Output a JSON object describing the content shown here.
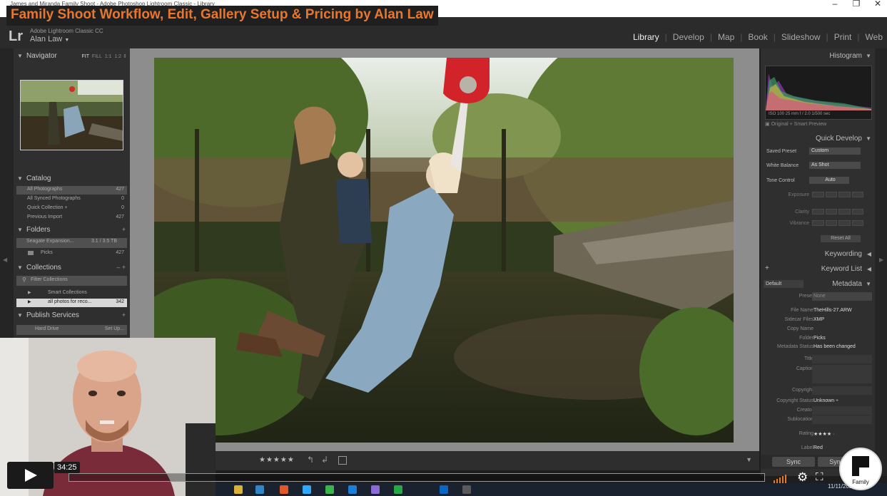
{
  "window": {
    "title": "James and Miranda Family Shoot - Adobe Photoshop Lightroom Classic - Library",
    "minimize": "–",
    "maximize": "❐",
    "close": "✕"
  },
  "video": {
    "title": "Family Shoot Workflow, Edit, Gallery Setup & Pricing by Alan Law",
    "time": "34:25",
    "brand_label": "Family"
  },
  "app": {
    "logo": "Lr",
    "product": "Adobe Lightroom Classic CC",
    "user": "Alan Law",
    "user_caret": "▼"
  },
  "modules": [
    "Library",
    "Develop",
    "Map",
    "Book",
    "Slideshow",
    "Print",
    "Web"
  ],
  "active_module": "Library",
  "left_panel": {
    "navigator": {
      "title": "Navigator",
      "zoom": [
        "FIT",
        "FILL",
        "1:1",
        "1:2"
      ]
    },
    "catalog": {
      "title": "Catalog",
      "items": [
        {
          "name": "All Photographs",
          "count": "427"
        },
        {
          "name": "All Synced Photographs",
          "count": "0"
        },
        {
          "name": "Quick Collection +",
          "count": "0"
        },
        {
          "name": "Previous Import",
          "count": "427"
        }
      ]
    },
    "folders": {
      "title": "Folders",
      "plus": "+",
      "volume": "Seagate Expansion...",
      "volume_info": "3.1 / 3.5 TB",
      "items": [
        {
          "name": "Picks",
          "count": "427"
        }
      ]
    },
    "collections": {
      "title": "Collections",
      "controls": "–  +",
      "filter": "Filter Collections",
      "items": [
        {
          "name": "Smart Collections",
          "count": ""
        },
        {
          "name": "all photos for reco...",
          "count": "342"
        }
      ]
    },
    "publish": {
      "title": "Publish Services",
      "plus": "+",
      "items": [
        {
          "name": "Hard Drive",
          "action": "Set Up..."
        }
      ]
    }
  },
  "toolbar": {
    "stars": "★★★★★"
  },
  "right_panel": {
    "histogram": {
      "title": "Histogram",
      "info": "ISO 100        25 mm        f / 2.0        1/500 sec",
      "preview": "Original + Smart Preview"
    },
    "quick_develop": {
      "title": "Quick Develop",
      "saved_preset": {
        "label": "Saved Preset",
        "value": "Custom"
      },
      "white_balance": {
        "label": "White Balance",
        "value": "As Shot"
      },
      "tone_control": {
        "label": "Tone Control",
        "value": "Auto"
      },
      "sliders": [
        "Exposure",
        "Clarity",
        "Vibrance"
      ],
      "reset": "Reset All"
    },
    "keywording": {
      "title": "Keywording"
    },
    "keyword_list": {
      "title": "Keyword List",
      "plus": "+"
    },
    "metadata": {
      "title": "Metadata",
      "mode": "Default",
      "preset": {
        "label": "Preset",
        "value": "None"
      },
      "fields": [
        {
          "label": "File Name",
          "value": "TheHills-27.ARW"
        },
        {
          "label": "Sidecar Files",
          "value": "XMP"
        },
        {
          "label": "Copy Name",
          "value": ""
        },
        {
          "label": "Folder",
          "value": "Picks"
        },
        {
          "label": "Metadata Status",
          "value": "Has been changed"
        },
        {
          "label": "Title",
          "value": ""
        },
        {
          "label": "Caption",
          "value": ""
        },
        {
          "label": "Copyright",
          "value": ""
        },
        {
          "label": "Copyright Status",
          "value": "Unknown ÷"
        },
        {
          "label": "Creator",
          "value": ""
        },
        {
          "label": "Sublocation",
          "value": ""
        },
        {
          "label": "Rating",
          "value": "★★★★ ·"
        },
        {
          "label": "Label",
          "value": "Red"
        }
      ]
    },
    "sync": {
      "metadata": "Sync",
      "settings": "Sync..."
    }
  },
  "taskbar": {
    "clock": "11/11/2020"
  },
  "colors": {
    "accent": "#e8772e",
    "panel": "#2f2f2f",
    "center_bg": "#8d8d8d"
  }
}
